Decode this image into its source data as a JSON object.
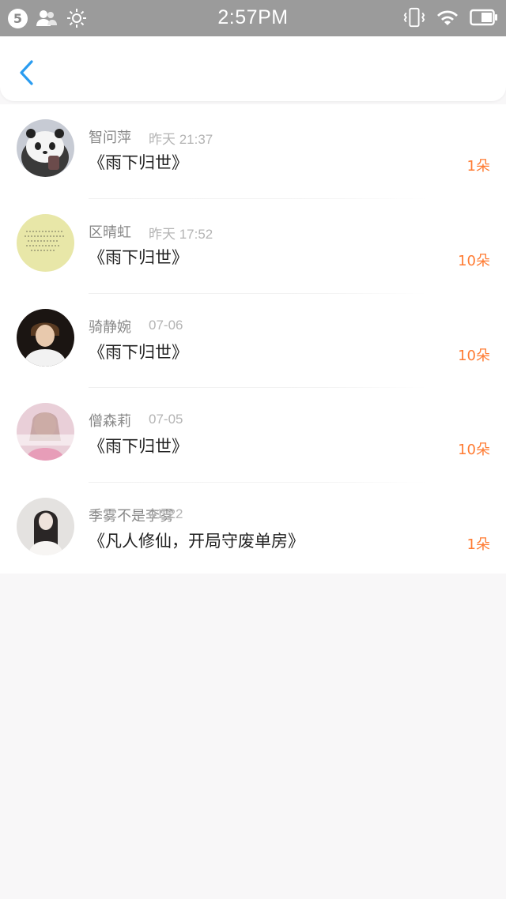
{
  "status_bar": {
    "notification_count": "5",
    "time": "2:57PM",
    "icons": [
      "contacts-icon",
      "brightness-icon",
      "vibrate-icon",
      "wifi-icon",
      "battery-icon"
    ]
  },
  "nav": {
    "back_icon": "chevron-left-icon",
    "accent": "#2a9cf0"
  },
  "items": [
    {
      "name": "智问萍",
      "time": "昨天 21:37",
      "book": "《雨下归世》",
      "count": "1朵",
      "avatar": "panda-avatar"
    },
    {
      "name": "区晴虹",
      "time": "昨天 17:52",
      "book": "《雨下归世》",
      "count": "10朵",
      "avatar": "handwriting-avatar"
    },
    {
      "name": "骑静婉",
      "time": "07-06",
      "book": "《雨下归世》",
      "count": "10朵",
      "avatar": "boy-avatar"
    },
    {
      "name": "僧森莉",
      "time": "07-05",
      "book": "《雨下归世》",
      "count": "10朵",
      "avatar": "girl-pink-avatar"
    },
    {
      "name": "季雾不是李雾",
      "time": "01-22",
      "book": "《凡人修仙，开局守废单房》",
      "count": "1朵",
      "avatar": "girl-mirror-avatar"
    }
  ],
  "colors": {
    "count": "#ff7b32",
    "status_bar": "#9b9b9b"
  }
}
